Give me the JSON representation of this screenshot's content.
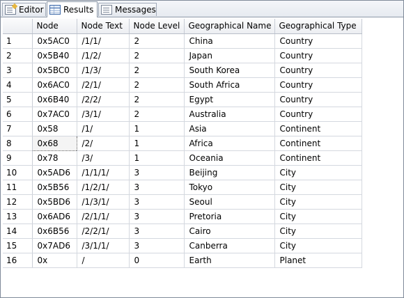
{
  "tabs": [
    {
      "label": "Editor",
      "icon": "editor-icon"
    },
    {
      "label": "Results",
      "icon": "results-grid-icon"
    },
    {
      "label": "Messages",
      "icon": "messages-icon"
    }
  ],
  "grid": {
    "columns": [
      "",
      "Node",
      "Node Text",
      "Node Level",
      "Geographical Name",
      "Geographical Type"
    ],
    "rows": [
      [
        "1",
        "0x5AC0",
        "/1/1/",
        "2",
        "China",
        "Country"
      ],
      [
        "2",
        "0x5B40",
        "/1/2/",
        "2",
        "Japan",
        "Country"
      ],
      [
        "3",
        "0x5BC0",
        "/1/3/",
        "2",
        "South Korea",
        "Country"
      ],
      [
        "4",
        "0x6AC0",
        "/2/1/",
        "2",
        "South Africa",
        "Country"
      ],
      [
        "5",
        "0x6B40",
        "/2/2/",
        "2",
        "Egypt",
        "Country"
      ],
      [
        "6",
        "0x7AC0",
        "/3/1/",
        "2",
        "Australia",
        "Country"
      ],
      [
        "7",
        "0x58",
        "/1/",
        "1",
        "Asia",
        "Continent"
      ],
      [
        "8",
        "0x68",
        "/2/",
        "1",
        "Africa",
        "Continent"
      ],
      [
        "9",
        "0x78",
        "/3/",
        "1",
        "Oceania",
        "Continent"
      ],
      [
        "10",
        "0x5AD6",
        "/1/1/1/",
        "3",
        "Beijing",
        "City"
      ],
      [
        "11",
        "0x5B56",
        "/1/2/1/",
        "3",
        "Tokyo",
        "City"
      ],
      [
        "12",
        "0x5BD6",
        "/1/3/1/",
        "3",
        "Seoul",
        "City"
      ],
      [
        "13",
        "0x6AD6",
        "/2/1/1/",
        "3",
        "Pretoria",
        "City"
      ],
      [
        "14",
        "0x6B56",
        "/2/2/1/",
        "3",
        "Cairo",
        "City"
      ],
      [
        "15",
        "0x7AD6",
        "/3/1/1/",
        "3",
        "Canberra",
        "City"
      ],
      [
        "16",
        "0x",
        "/",
        "0",
        "Earth",
        "Planet"
      ]
    ],
    "selected_cell": {
      "row": 7,
      "col": 1
    }
  }
}
